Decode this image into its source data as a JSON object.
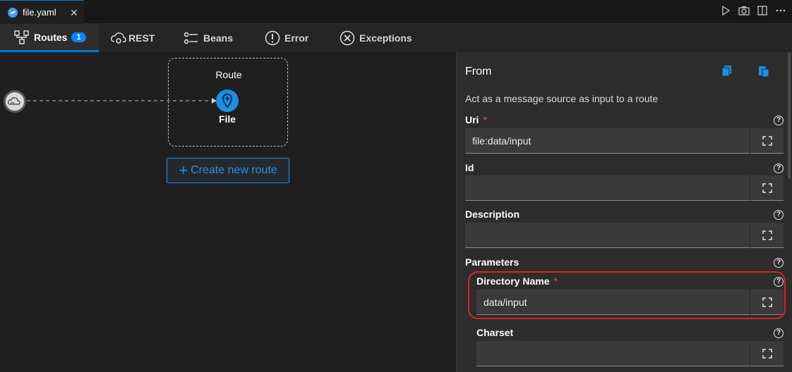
{
  "window": {
    "file_tab": "file.yaml",
    "close_glyph": "✕",
    "actions": [
      "play-icon",
      "camera-icon",
      "split-editor-icon",
      "more-icon"
    ]
  },
  "nav": {
    "tabs": [
      {
        "label": "Routes",
        "icon": "routes-icon",
        "badge": "1",
        "active": true
      },
      {
        "label": "REST",
        "icon": "rest-cloud-icon"
      },
      {
        "label": "Beans",
        "icon": "beans-icon"
      },
      {
        "label": "Error",
        "icon": "error-icon"
      },
      {
        "label": "Exceptions",
        "icon": "exceptions-icon"
      }
    ]
  },
  "canvas": {
    "route_title": "Route",
    "node_label": "File",
    "create_button": "Create new route",
    "create_plus": "+"
  },
  "panel": {
    "title": "From",
    "description": "Act as a message source as input to a route",
    "fields": {
      "uri": {
        "label": "Uri",
        "required": "*",
        "value": "file:data/input"
      },
      "id": {
        "label": "Id",
        "value": ""
      },
      "description": {
        "label": "Description",
        "value": ""
      },
      "parameters": {
        "label": "Parameters"
      },
      "directory_name": {
        "label": "Directory Name",
        "required": "*",
        "value": "data/input"
      },
      "charset": {
        "label": "Charset",
        "value": ""
      }
    },
    "help_glyph": "?"
  },
  "colors": {
    "accent": "#0078d4",
    "badge": "#0a84ff",
    "node": "#1a8fe3",
    "highlight": "#e0202a",
    "required": "#e05252"
  }
}
